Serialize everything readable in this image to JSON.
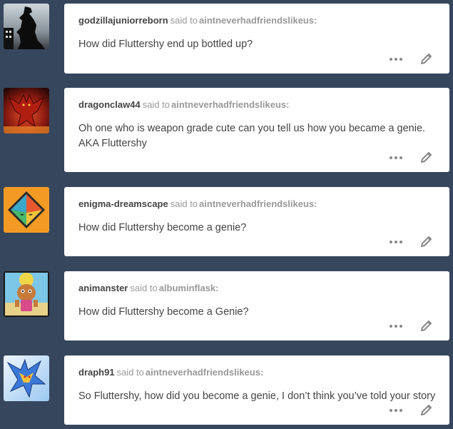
{
  "said_to_text": "said to",
  "colors": {
    "background": "#36465d",
    "card": "#ffffff",
    "username": "#444444",
    "meta": "#999999",
    "icon": "#888888"
  },
  "posts": [
    {
      "username": "godzillajuniorreborn",
      "recipient": "aintneverhadfriendslikeus:",
      "message": "How did Fluttershy end up bottled up?",
      "avatar_icon": "godzilla-silhouette-avatar"
    },
    {
      "username": "dragonclaw44",
      "recipient": "aintneverhadfriendslikeus:",
      "message": "Oh one who is weapon grade cute can you tell us how you became a genie. AKA Fluttershy",
      "avatar_icon": "red-dragon-avatar"
    },
    {
      "username": "enigma-dreamscape",
      "recipient": "aintneverhadfriendslikeus:",
      "message": "How did Fluttershy become a genie?",
      "avatar_icon": "octahedron-face-avatar"
    },
    {
      "username": "animanster",
      "recipient": "albuminflask:",
      "message": "How did Fluttershy become a Genie?",
      "avatar_icon": "cartoon-character-beach-avatar"
    },
    {
      "username": "draph91",
      "recipient": "aintneverhadfriendslikeus:",
      "message": "So Fluttershy, how did you become a genie, I don’t think you’ve told your story",
      "avatar_icon": "blue-dragon-anime-avatar"
    }
  ]
}
